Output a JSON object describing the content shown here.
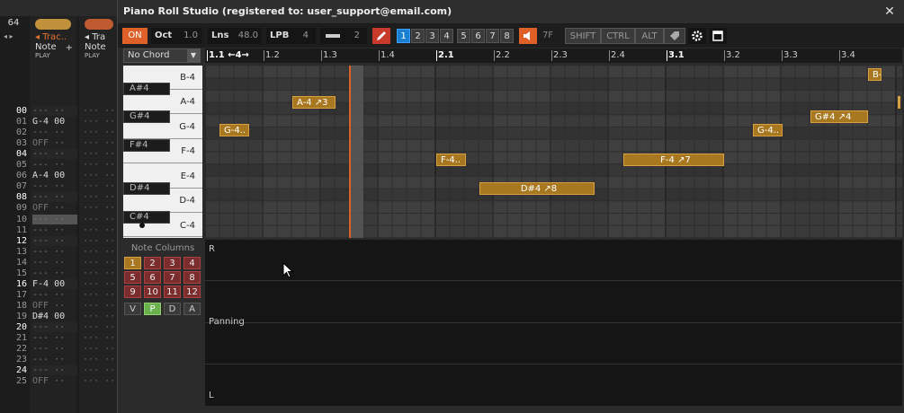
{
  "tracker": {
    "lpb_value": "64",
    "arrows": "◂ ▸",
    "tracks": [
      {
        "name": "◂ Trac..",
        "column_label": "Note",
        "play_label": "PLAY",
        "add_icon": "+"
      },
      {
        "name": "◂ Tra",
        "column_label": "Note",
        "play_label": "PLAY",
        "add_icon": "+"
      }
    ],
    "rows": [
      {
        "num": "00",
        "cell": "--- ··",
        "cell2": "··· ··"
      },
      {
        "num": "01",
        "cell": "G-4 00",
        "cell2": "··· ··"
      },
      {
        "num": "02",
        "cell": "--- ··",
        "cell2": "··· ··"
      },
      {
        "num": "03",
        "cell": "OFF ··",
        "cell2": "··· ··"
      },
      {
        "num": "04",
        "cell": "--- ··",
        "cell2": "··· ··"
      },
      {
        "num": "05",
        "cell": "--- ··",
        "cell2": "··· ··"
      },
      {
        "num": "06",
        "cell": "A-4 00",
        "cell2": "··· ··"
      },
      {
        "num": "07",
        "cell": "--- ··",
        "cell2": "··· ··"
      },
      {
        "num": "08",
        "cell": "--- ··",
        "cell2": "··· ··"
      },
      {
        "num": "09",
        "cell": "OFF ··",
        "cell2": "··· ··"
      },
      {
        "num": "10",
        "cell": "--- ··",
        "cell2": "··· ··"
      },
      {
        "num": "11",
        "cell": "--- ··",
        "cell2": "··· ··"
      },
      {
        "num": "12",
        "cell": "--- ··",
        "cell2": "··· ··"
      },
      {
        "num": "13",
        "cell": "--- ··",
        "cell2": "··· ··"
      },
      {
        "num": "14",
        "cell": "--- ··",
        "cell2": "··· ··"
      },
      {
        "num": "15",
        "cell": "--- ··",
        "cell2": "··· ··"
      },
      {
        "num": "16",
        "cell": "F-4 00",
        "cell2": "··· ··"
      },
      {
        "num": "17",
        "cell": "--- ··",
        "cell2": "··· ··"
      },
      {
        "num": "18",
        "cell": "OFF ··",
        "cell2": "··· ··"
      },
      {
        "num": "19",
        "cell": "D#4 00",
        "cell2": "··· ··"
      },
      {
        "num": "20",
        "cell": "--- ··",
        "cell2": "··· ··"
      },
      {
        "num": "21",
        "cell": "--- ··",
        "cell2": "··· ··"
      },
      {
        "num": "22",
        "cell": "--- ··",
        "cell2": "··· ··"
      },
      {
        "num": "23",
        "cell": "--- ··",
        "cell2": "··· ··"
      },
      {
        "num": "24",
        "cell": "--- ··",
        "cell2": "··· ··"
      },
      {
        "num": "25",
        "cell": "OFF ··",
        "cell2": "··· ··"
      }
    ]
  },
  "window": {
    "title": "Piano Roll Studio  (registered to: user_support@email.com)",
    "close_icon": "✕"
  },
  "toolbar": {
    "on_label": "ON",
    "oct_label": "Oct",
    "oct_value": "1.0",
    "lns_label": "Lns",
    "lns_value": "48.0",
    "lpb_label": "LPB",
    "lpb_value": "4",
    "step_value": "2",
    "edit_icon": "pencil-icon",
    "numbers": [
      "1",
      "2",
      "3",
      "4",
      "5",
      "6",
      "7",
      "8"
    ],
    "speaker_icon": "speaker-icon",
    "seven_f": "7F",
    "shift_label": "SHIFT",
    "ctrl_label": "CTRL",
    "alt_label": "ALT",
    "tag_icon": "tag-icon",
    "gear_icon": "gear-icon",
    "window_icon": "window-icon"
  },
  "chord": {
    "label": "No Chord",
    "arrow": "▼"
  },
  "keys": {
    "white": [
      "B-4",
      "A-4",
      "G-4",
      "F-4",
      "E-4",
      "D-4",
      "C-4"
    ],
    "black": [
      "A#4",
      "G#4",
      "F#4",
      "D#4",
      "C#4"
    ]
  },
  "note_columns": {
    "title": "Note Columns",
    "buttons": [
      "1",
      "2",
      "3",
      "4",
      "5",
      "6",
      "7",
      "8",
      "9",
      "10",
      "11",
      "12"
    ],
    "vpda": [
      "V",
      "P",
      "D",
      "A"
    ]
  },
  "ruler": {
    "labels": [
      "1.1 ←4→",
      "1.2",
      "1.3",
      "1.4",
      "2.1",
      "2.2",
      "2.3",
      "2.4",
      "3.1",
      "3.2",
      "3.3",
      "3.4"
    ]
  },
  "notes": [
    {
      "label": "B-",
      "pitch": "B-4"
    },
    {
      "label": "A-4 ↗3",
      "pitch": "A-4"
    },
    {
      "label": "G-4..",
      "pitch": "G-4"
    },
    {
      "label": "F-4..",
      "pitch": "F-4"
    },
    {
      "label": "F-4 ↗7",
      "pitch": "F-4"
    },
    {
      "label": "D#4 ↗8",
      "pitch": "D#4"
    },
    {
      "label": "G-4..",
      "pitch": "G-4"
    },
    {
      "label": "G#4 ↗4",
      "pitch": "G#4"
    }
  ],
  "automation": {
    "top_label": "R",
    "mid_label": "Panning",
    "bottom_label": "L"
  },
  "colors": {
    "accent": "#e0602a",
    "note": "#a87820",
    "note_column": "#7b2c2c",
    "number_selected": "#1a7fd0",
    "playhead": "#e0602a"
  }
}
